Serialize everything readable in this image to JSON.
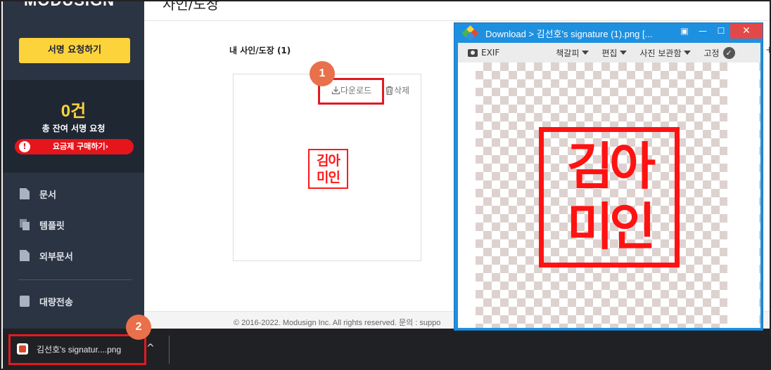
{
  "sidebar": {
    "logo": "MODUSIGN",
    "sign_request_label": "서명 요청하기",
    "credits": {
      "count": "0건",
      "label": "총 잔여 서명 요청",
      "buy_label": "요금제 구매하기",
      "buy_arrow": "›",
      "warn_glyph": "!"
    },
    "items": [
      {
        "label": "문서",
        "icon": "document-icon"
      },
      {
        "label": "템플릿",
        "icon": "template-icon"
      },
      {
        "label": "외부문서",
        "icon": "external-document-icon"
      },
      {
        "label": "대량전송",
        "icon": "bulk-send-icon"
      }
    ]
  },
  "main": {
    "page_title": "사인/도장",
    "section_title": "내 사인/도장 (1)",
    "download_label": "다운로드",
    "delete_label": "삭제",
    "stamp_line1": "김아",
    "stamp_line2": "미인",
    "badge1": "1",
    "footer": "© 2016-2022. Modusign Inc. All rights reserved.  문의 : suppo"
  },
  "download_bar": {
    "file_name": "김선호's signatur....png",
    "badge2": "2",
    "chevron": "^"
  },
  "viewer": {
    "title": "Download > 김선호's signature (1).png [...",
    "toolbar": {
      "exif": "EXIF",
      "bookmark": "책갈피",
      "edit": "편집",
      "photo_storage": "사진 보관함",
      "pin": "고정",
      "check_glyph": "✓",
      "plus": "+"
    },
    "window_buttons": {
      "fit": "▣",
      "minimize": "—",
      "maximize": "☐",
      "close": "✕"
    },
    "stamp_line1": "김아",
    "stamp_line2": "미인"
  },
  "colors": {
    "sidebar": "#2b3442",
    "accent_yellow": "#fdd33c",
    "stamp_red": "#ff1212",
    "viewer_blue": "#1e90e0",
    "highlight": "#e01a22"
  }
}
